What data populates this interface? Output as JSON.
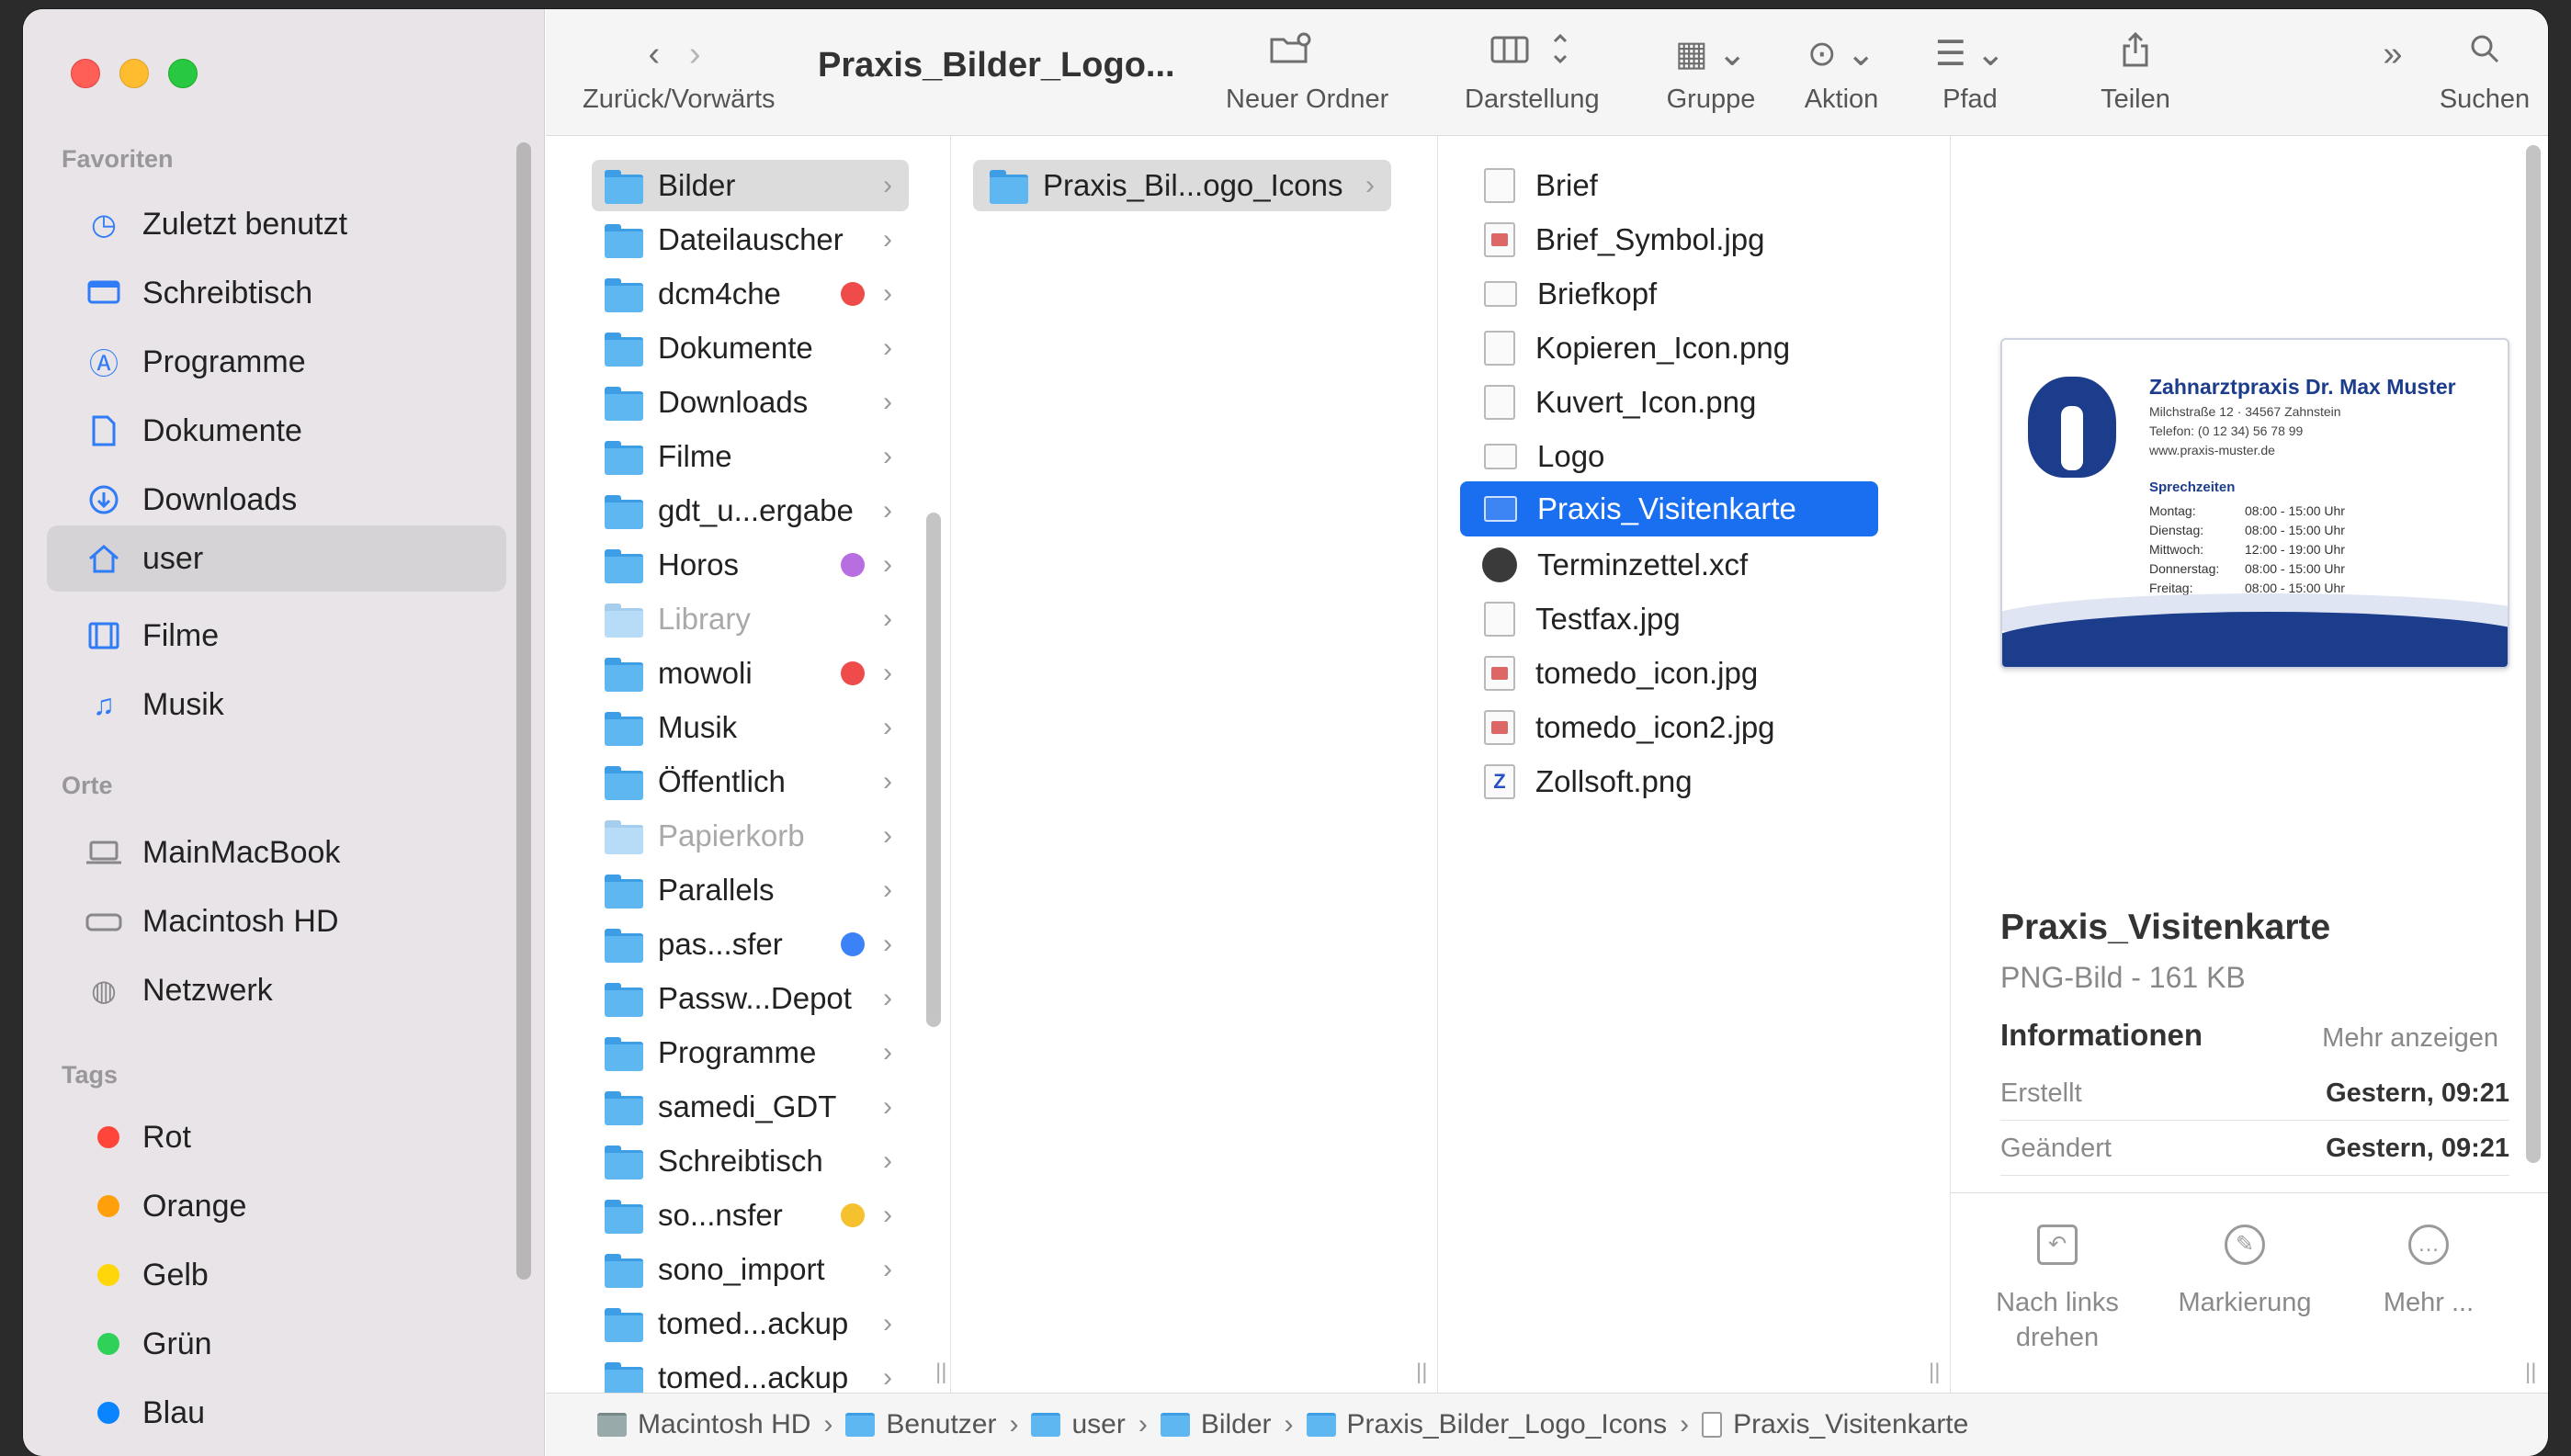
{
  "toolbar": {
    "title": "Praxis_Bilder_Logo...",
    "back_forward": "Zurück/Vorwärts",
    "new_folder": "Neuer Ordner",
    "view": "Darstellung",
    "group": "Gruppe",
    "action": "Aktion",
    "path": "Pfad",
    "share": "Teilen",
    "search": "Suchen"
  },
  "sidebar": {
    "favorites_header": "Favoriten",
    "favorites": [
      {
        "label": "Zuletzt benutzt",
        "icon": "clock-icon"
      },
      {
        "label": "Schreibtisch",
        "icon": "desktop-icon"
      },
      {
        "label": "Programme",
        "icon": "apps-icon"
      },
      {
        "label": "Dokumente",
        "icon": "document-icon"
      },
      {
        "label": "Downloads",
        "icon": "download-icon"
      },
      {
        "label": "user",
        "icon": "home-icon",
        "selected": true
      },
      {
        "label": "Filme",
        "icon": "film-icon"
      },
      {
        "label": "Musik",
        "icon": "music-icon"
      }
    ],
    "places_header": "Orte",
    "places": [
      {
        "label": "MainMacBook",
        "icon": "laptop-icon"
      },
      {
        "label": "Macintosh HD",
        "icon": "disk-icon"
      },
      {
        "label": "Netzwerk",
        "icon": "network-icon"
      }
    ],
    "tags_header": "Tags",
    "tags": [
      {
        "label": "Rot",
        "color": "#ff453a"
      },
      {
        "label": "Orange",
        "color": "#ff9f0a"
      },
      {
        "label": "Gelb",
        "color": "#ffd60a"
      },
      {
        "label": "Grün",
        "color": "#30d158"
      },
      {
        "label": "Blau",
        "color": "#0a84ff"
      }
    ]
  },
  "column1": [
    {
      "label": "Bilder",
      "selected": true
    },
    {
      "label": "Dateilauscher"
    },
    {
      "label": "dcm4che",
      "tag": "#f04b4b"
    },
    {
      "label": "Dokumente"
    },
    {
      "label": "Downloads"
    },
    {
      "label": "Filme"
    },
    {
      "label": "gdt_u...ergabe"
    },
    {
      "label": "Horos",
      "tag": "#b76ee0"
    },
    {
      "label": "Library",
      "dim": true
    },
    {
      "label": "mowoli",
      "tag": "#f04b4b"
    },
    {
      "label": "Musik"
    },
    {
      "label": "Öffentlich"
    },
    {
      "label": "Papierkorb",
      "dim": true
    },
    {
      "label": "Parallels"
    },
    {
      "label": "pas...sfer",
      "tag": "#3b82f6"
    },
    {
      "label": "Passw...Depot"
    },
    {
      "label": "Programme"
    },
    {
      "label": "samedi_GDT"
    },
    {
      "label": "Schreibtisch"
    },
    {
      "label": "so...nsfer",
      "tag": "#f5c12e"
    },
    {
      "label": "sono_import"
    },
    {
      "label": "tomed...ackup"
    },
    {
      "label": "tomed...ackup"
    }
  ],
  "column2": [
    {
      "label": "Praxis_Bil...ogo_Icons",
      "selected": true
    }
  ],
  "column3": [
    {
      "label": "Brief",
      "icon": "document-icon"
    },
    {
      "label": "Brief_Symbol.jpg",
      "icon": "image-icon"
    },
    {
      "label": "Briefkopf",
      "icon": "document-icon"
    },
    {
      "label": "Kopieren_Icon.png",
      "icon": "image-icon"
    },
    {
      "label": "Kuvert_Icon.png",
      "icon": "image-icon"
    },
    {
      "label": "Logo",
      "icon": "document-icon"
    },
    {
      "label": "Praxis_Visitenkarte",
      "icon": "image-icon",
      "selected": true
    },
    {
      "label": "Terminzettel.xcf",
      "icon": "gimp-icon"
    },
    {
      "label": "Testfax.jpg",
      "icon": "image-icon"
    },
    {
      "label": "tomedo_icon.jpg",
      "icon": "image-icon"
    },
    {
      "label": "tomedo_icon2.jpg",
      "icon": "image-icon"
    },
    {
      "label": "Zollsoft.png",
      "icon": "image-icon"
    }
  ],
  "card": {
    "title": "Zahnarztpraxis Dr. Max Muster",
    "address": "Milchstraße 12 · 34567 Zahnstein",
    "phone": "Telefon: (0 12 34) 56 78 99",
    "web": "www.praxis-muster.de",
    "hours_title": "Sprechzeiten",
    "hours": [
      {
        "day": "Montag:",
        "time": "08:00 - 15:00 Uhr"
      },
      {
        "day": "Dienstag:",
        "time": "08:00 - 15:00 Uhr"
      },
      {
        "day": "Mittwoch:",
        "time": "12:00 - 19:00 Uhr"
      },
      {
        "day": "Donnerstag:",
        "time": "08:00 - 15:00 Uhr"
      },
      {
        "day": "Freitag:",
        "time": "08:00 - 15:00 Uhr"
      }
    ]
  },
  "preview": {
    "name": "Praxis_Visitenkarte",
    "kind": "PNG-Bild - 161 KB",
    "info_header": "Informationen",
    "show_more": "Mehr anzeigen",
    "created_label": "Erstellt",
    "created_value": "Gestern, 09:21",
    "modified_label": "Geändert",
    "modified_value": "Gestern, 09:21",
    "actions": [
      {
        "label": "Nach links drehen",
        "icon": "rotate-left-icon"
      },
      {
        "label": "Markierung",
        "icon": "markup-icon"
      },
      {
        "label": "Mehr ...",
        "icon": "more-icon"
      }
    ]
  },
  "pathbar": [
    {
      "label": "Macintosh HD",
      "icon": "disk-icon"
    },
    {
      "label": "Benutzer",
      "icon": "folder-icon"
    },
    {
      "label": "user",
      "icon": "home-icon"
    },
    {
      "label": "Bilder",
      "icon": "folder-icon"
    },
    {
      "label": "Praxis_Bilder_Logo_Icons",
      "icon": "folder-icon"
    },
    {
      "label": "Praxis_Visitenkarte",
      "icon": "file-icon"
    }
  ]
}
